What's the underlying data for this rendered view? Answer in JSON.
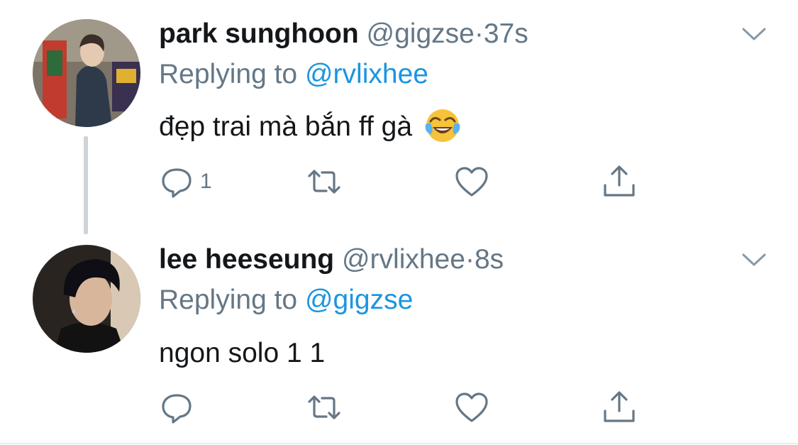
{
  "tweets": [
    {
      "name": "park sunghoon",
      "handle": "@gigzse",
      "dot": "·",
      "time": "37s",
      "replying_prefix": "Replying to",
      "replying_handle": "@rvlixhee",
      "text": "đẹp trai mà bắn ff gà",
      "emoji": "face-with-tears-of-joy",
      "reply_count": "1"
    },
    {
      "name": "lee heeseung",
      "handle": "@rvlixhee",
      "dot": "·",
      "time": "8s",
      "replying_prefix": "Replying to",
      "replying_handle": "@gigzse",
      "text": "ngon solo 1 1",
      "reply_count": ""
    }
  ],
  "icons": {
    "reply": "reply-icon",
    "retweet": "retweet-icon",
    "like": "heart-icon",
    "share": "share-icon",
    "more": "chevron-down-icon"
  },
  "colors": {
    "link": "#1b95e0",
    "secondary": "#657786",
    "thread_line": "#cdd4da"
  }
}
